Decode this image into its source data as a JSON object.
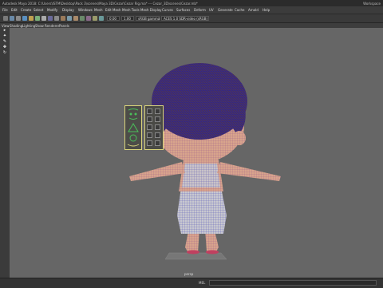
{
  "window": {
    "title": "Autodesk Maya 2018: C:\\Users\\ISTM\\Desktop\\Pack 3\\scenes\\Maya 3D\\Cezar\\Cezar Rig.ma* --- Cezar_3D\\scenes\\Cezar.mb*",
    "right_label": "Workspace"
  },
  "menu": [
    "File",
    "Edit",
    "Create",
    "Select",
    "Modify",
    "Display",
    "Windows",
    "Mesh",
    "Edit Mesh",
    "Mesh Tools",
    "Mesh Display",
    "Curves",
    "Surfaces",
    "Deform",
    "UV",
    "Generate",
    "Cache",
    "Arnold",
    "Help"
  ],
  "toolbar": {
    "field1": "0.00",
    "field2": "1.00",
    "field3": "sRGB gamma",
    "field4": "ACES 1.0 SDR-video (sRGB)"
  },
  "panel_menu": [
    "View",
    "Shading",
    "Lighting",
    "Show",
    "Renderer",
    "Panels"
  ],
  "viewport": {
    "camera_label": "persp"
  },
  "cmdline": {
    "label": "MEL"
  },
  "colors": {
    "viewport_bg": "#666666",
    "hair": "#3a2a8c",
    "wire": "#2a2aa8",
    "skin": "#d9a58a",
    "picker_border": "#d9d47a"
  }
}
